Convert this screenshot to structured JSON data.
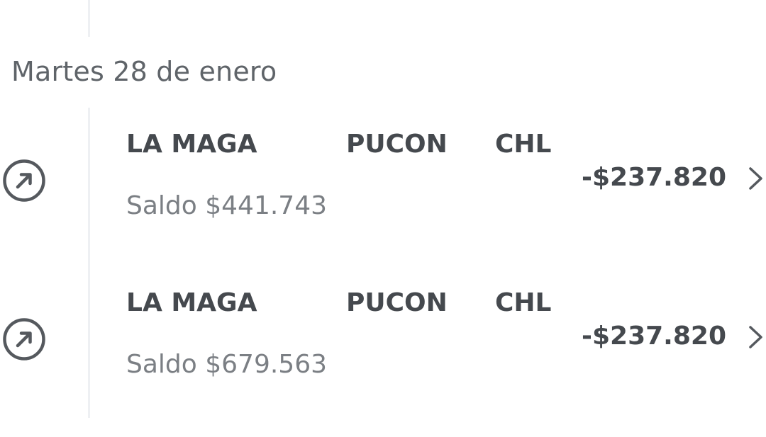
{
  "date_header": "Martes 28 de enero",
  "transactions": [
    {
      "merchant": "LA MAGA",
      "city": "PUCON",
      "country": "CHL",
      "balance": "Saldo $441.743",
      "amount": "-$237.820",
      "icon": "arrow-up-right-circle-icon",
      "chevron": "chevron-right-icon"
    },
    {
      "merchant": "LA MAGA",
      "city": "PUCON",
      "country": "CHL",
      "balance": "Saldo $679.563",
      "amount": "-$237.820",
      "icon": "arrow-up-right-circle-icon",
      "chevron": "chevron-right-icon"
    }
  ],
  "colors": {
    "primary_text": "#45494e",
    "secondary_text": "#7b7f84",
    "header_text": "#5f6469",
    "icon": "#55595e",
    "timeline": "#eef0f3"
  }
}
